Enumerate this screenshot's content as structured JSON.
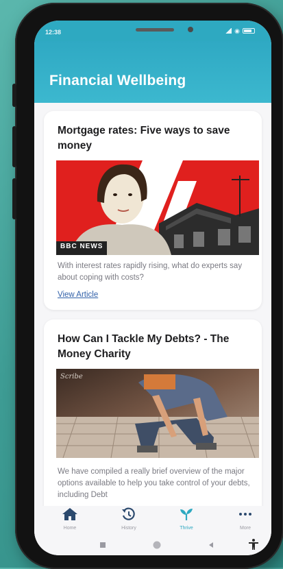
{
  "status": {
    "time": "12:38"
  },
  "app": {
    "title": "Financial Wellbeing"
  },
  "articles": [
    {
      "title": "Mortgage rates: Five ways to save money",
      "image_caption": "BBC NEWS",
      "description": "With interest rates rapidly rising, what do experts say about coping with costs?",
      "link_label": "View Article"
    },
    {
      "title": "How Can I Tackle My Debts? - The Money Charity",
      "description": "We have compiled a really brief overview of the major options available to help you take control of your debts, including Debt"
    }
  ],
  "nav": {
    "items": [
      {
        "label": "Home",
        "icon": "home-icon"
      },
      {
        "label": "History",
        "icon": "history-icon"
      },
      {
        "label": "Thrive",
        "icon": "sprout-icon"
      },
      {
        "label": "More",
        "icon": "more-icon"
      }
    ],
    "active": "Thrive"
  },
  "colors": {
    "accent": "#2ea9c1",
    "link": "#2f5fa8",
    "image_red": "#e0201e",
    "background": "#3e9c94"
  }
}
